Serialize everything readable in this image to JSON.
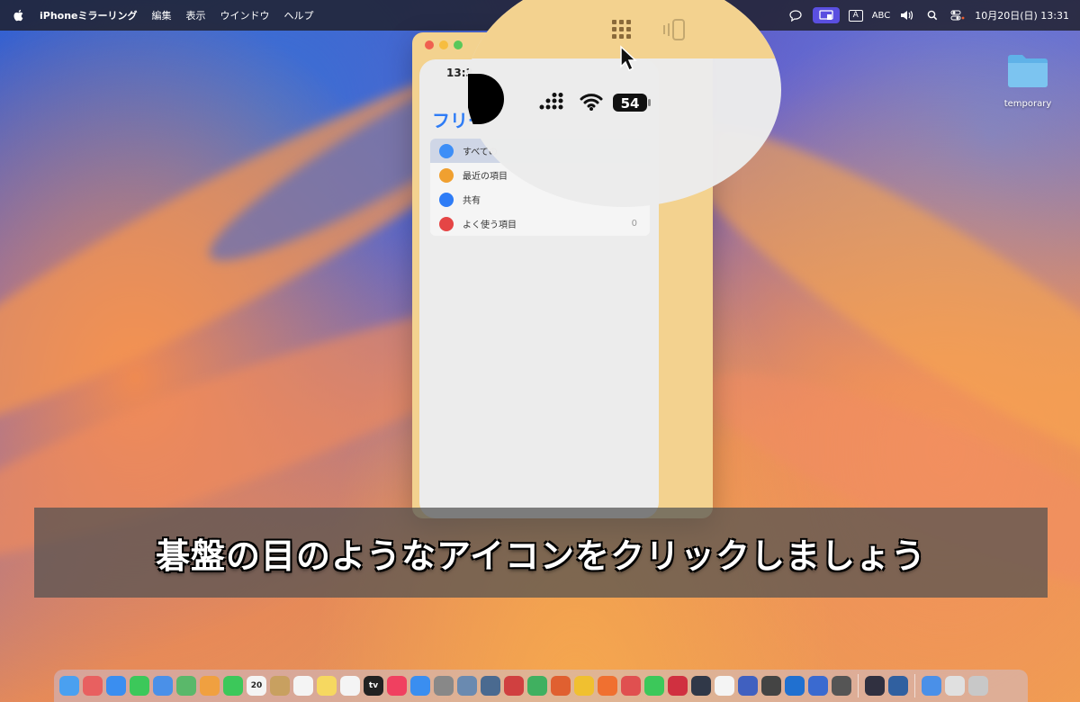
{
  "menubar": {
    "app_name": "iPhoneミラーリング",
    "menus": [
      "編集",
      "表示",
      "ウインドウ",
      "ヘルプ"
    ],
    "input_label": "ABC",
    "datetime": "10月20日(日)  13:31"
  },
  "desktop": {
    "folder_label": "temporary"
  },
  "phone": {
    "time": "13:3",
    "files_title": "フリー",
    "battery": "54",
    "items": [
      {
        "label": "すべての",
        "color": "#3d8ef7"
      },
      {
        "label": "最近の項目",
        "color": "#f0a030"
      },
      {
        "label": "共有",
        "color": "#2e7cf6"
      },
      {
        "label": "よく使う項目",
        "color": "#e54545",
        "count": "0"
      }
    ]
  },
  "caption": {
    "text": "碁盤の目のようなアイコンをクリックしましょう"
  },
  "dock": {
    "calendar_day": "20",
    "tv_label": "tv",
    "icons": [
      {
        "name": "finder",
        "color": "#4aa0f0"
      },
      {
        "name": "launchpad",
        "color": "#e86060"
      },
      {
        "name": "safari",
        "color": "#3a8ef0"
      },
      {
        "name": "messages",
        "color": "#3cc85a"
      },
      {
        "name": "mail",
        "color": "#4a90e8"
      },
      {
        "name": "maps",
        "color": "#5ab86a"
      },
      {
        "name": "photos",
        "color": "#f0a040"
      },
      {
        "name": "facetime",
        "color": "#3cc85a"
      },
      {
        "name": "calendar",
        "color": "#f4f4f4"
      },
      {
        "name": "contacts",
        "color": "#c8a060"
      },
      {
        "name": "reminders",
        "color": "#f4f4f4"
      },
      {
        "name": "notes",
        "color": "#f6d860"
      },
      {
        "name": "freeform",
        "color": "#f4f4f4"
      },
      {
        "name": "tv",
        "color": "#222222"
      },
      {
        "name": "music",
        "color": "#f04060"
      },
      {
        "name": "app-store",
        "color": "#3a8ef0"
      },
      {
        "name": "settings",
        "color": "#888888"
      },
      {
        "name": "preview",
        "color": "#6a8ab0"
      },
      {
        "name": "image-capture",
        "color": "#4a6a90"
      },
      {
        "name": "photo-app",
        "color": "#d04040"
      },
      {
        "name": "numbers",
        "color": "#40b060"
      },
      {
        "name": "keynote",
        "color": "#e06030"
      },
      {
        "name": "chrome",
        "color": "#f0c030"
      },
      {
        "name": "firefox",
        "color": "#f07030"
      },
      {
        "name": "paint",
        "color": "#e05050"
      },
      {
        "name": "line",
        "color": "#3cc85a"
      },
      {
        "name": "app-red",
        "color": "#d03040"
      },
      {
        "name": "app-dark",
        "color": "#303848"
      },
      {
        "name": "pen-app",
        "color": "#f4f4f4"
      },
      {
        "name": "hand-app",
        "color": "#4060c0"
      },
      {
        "name": "chatgpt",
        "color": "#444444"
      },
      {
        "name": "app-blue",
        "color": "#2070d0"
      },
      {
        "name": "text-app",
        "color": "#3a6ad0"
      },
      {
        "name": "calculator",
        "color": "#555555"
      },
      {
        "name": "iphone-mirroring",
        "color": "#303040"
      },
      {
        "name": "quicktime",
        "color": "#3060a0"
      },
      {
        "name": "downloads",
        "color": "#4a90e8"
      },
      {
        "name": "document",
        "color": "#e0e0e0"
      },
      {
        "name": "trash",
        "color": "#c8c8c8"
      }
    ]
  }
}
